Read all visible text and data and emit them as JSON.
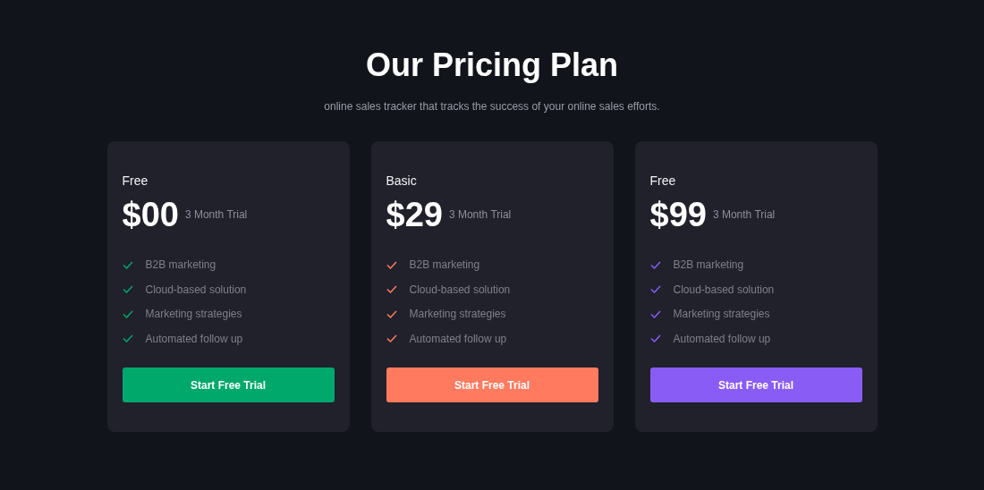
{
  "title": "Our Pricing Plan",
  "subtitle": "online sales tracker that tracks the success of your online sales efforts.",
  "plans": [
    {
      "name": "Free",
      "price": "$00",
      "term": "3 Month Trial",
      "color": "#00a96b",
      "features": [
        "B2B marketing",
        "Cloud-based solution",
        "Marketing strategies",
        "Automated follow up"
      ],
      "button": "Start Free Trial"
    },
    {
      "name": "Basic",
      "price": "$29",
      "term": "3 Month Trial",
      "color": "#ff7a5e",
      "features": [
        "B2B marketing",
        "Cloud-based solution",
        "Marketing strategies",
        "Automated follow up"
      ],
      "button": "Start Free Trial"
    },
    {
      "name": "Free",
      "price": "$99",
      "term": "3 Month Trial",
      "color": "#8a5cf6",
      "features": [
        "B2B marketing",
        "Cloud-based solution",
        "Marketing strategies",
        "Automated follow up"
      ],
      "button": "Start Free Trial"
    }
  ]
}
